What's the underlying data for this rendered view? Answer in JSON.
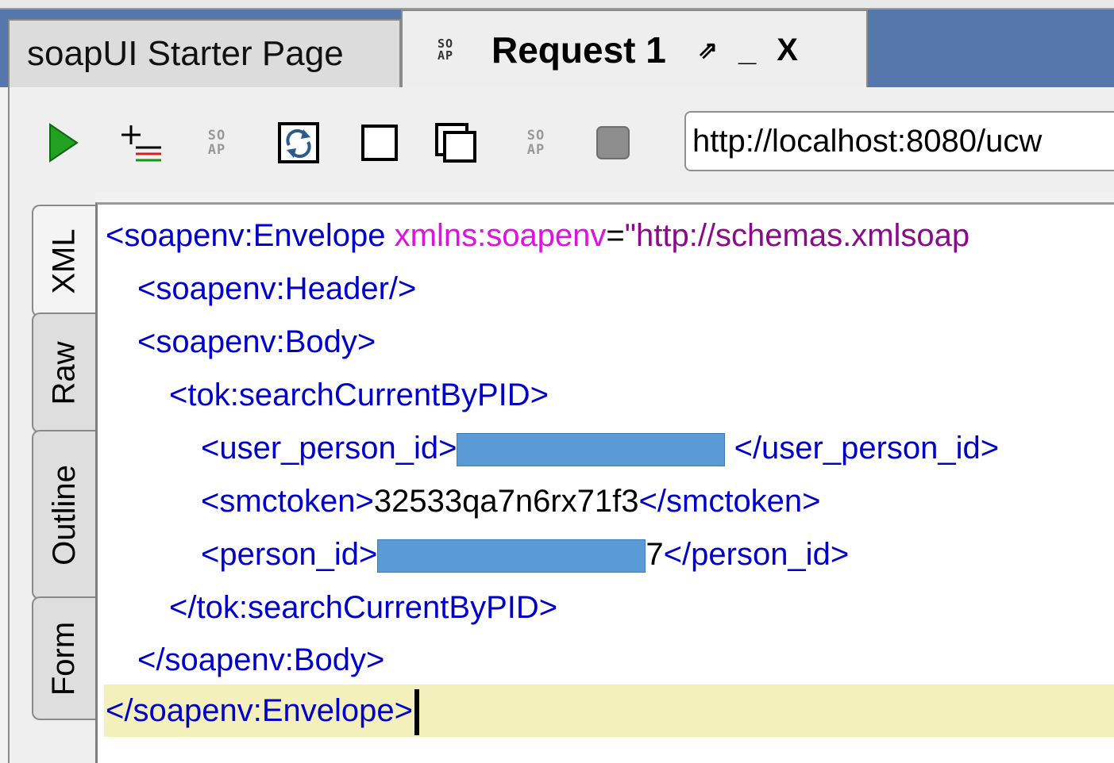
{
  "tabs": {
    "starter_label": "soapUI Starter Page",
    "request_label": "Request 1",
    "soap_logo_top": "SO",
    "soap_logo_bottom": "AP",
    "detach": "⇗",
    "minimize": "_",
    "close": "X"
  },
  "toolbar": {
    "endpoint_url": "http://localhost:8080/ucw"
  },
  "side_tabs": [
    "XML",
    "Raw",
    "Outline",
    "Form"
  ],
  "editor": {
    "line1": {
      "open": "<soapenv:Envelope ",
      "attr": "xmlns:soapenv",
      "eq": "=",
      "value": "\"http://schemas.xmlsoap"
    },
    "line2": "<soapenv:Header/>",
    "line3": "<soapenv:Body>",
    "line4": "<tok:searchCurrentByPID>",
    "line5": {
      "open": "<user_person_id>",
      "close": " </user_person_id>"
    },
    "line6": {
      "open": "<smctoken>",
      "text": "32533qa7n6rx71f3",
      "close": "</smctoken>"
    },
    "line7": {
      "open": "<person_id>",
      "tail": "7",
      "close": "</person_id>"
    },
    "line8": "</tok:searchCurrentByPID>",
    "line9": "</soapenv:Body>",
    "line10": "</soapenv:Envelope>"
  },
  "colors": {
    "tag": "#0000cc",
    "attribute": "#e010e0",
    "attribute_value": "#8b0a8b",
    "current_line": "#f3f0bb",
    "tab_bar": "#5577ab",
    "redaction": "#5b9bd5",
    "run": "#22a022"
  }
}
